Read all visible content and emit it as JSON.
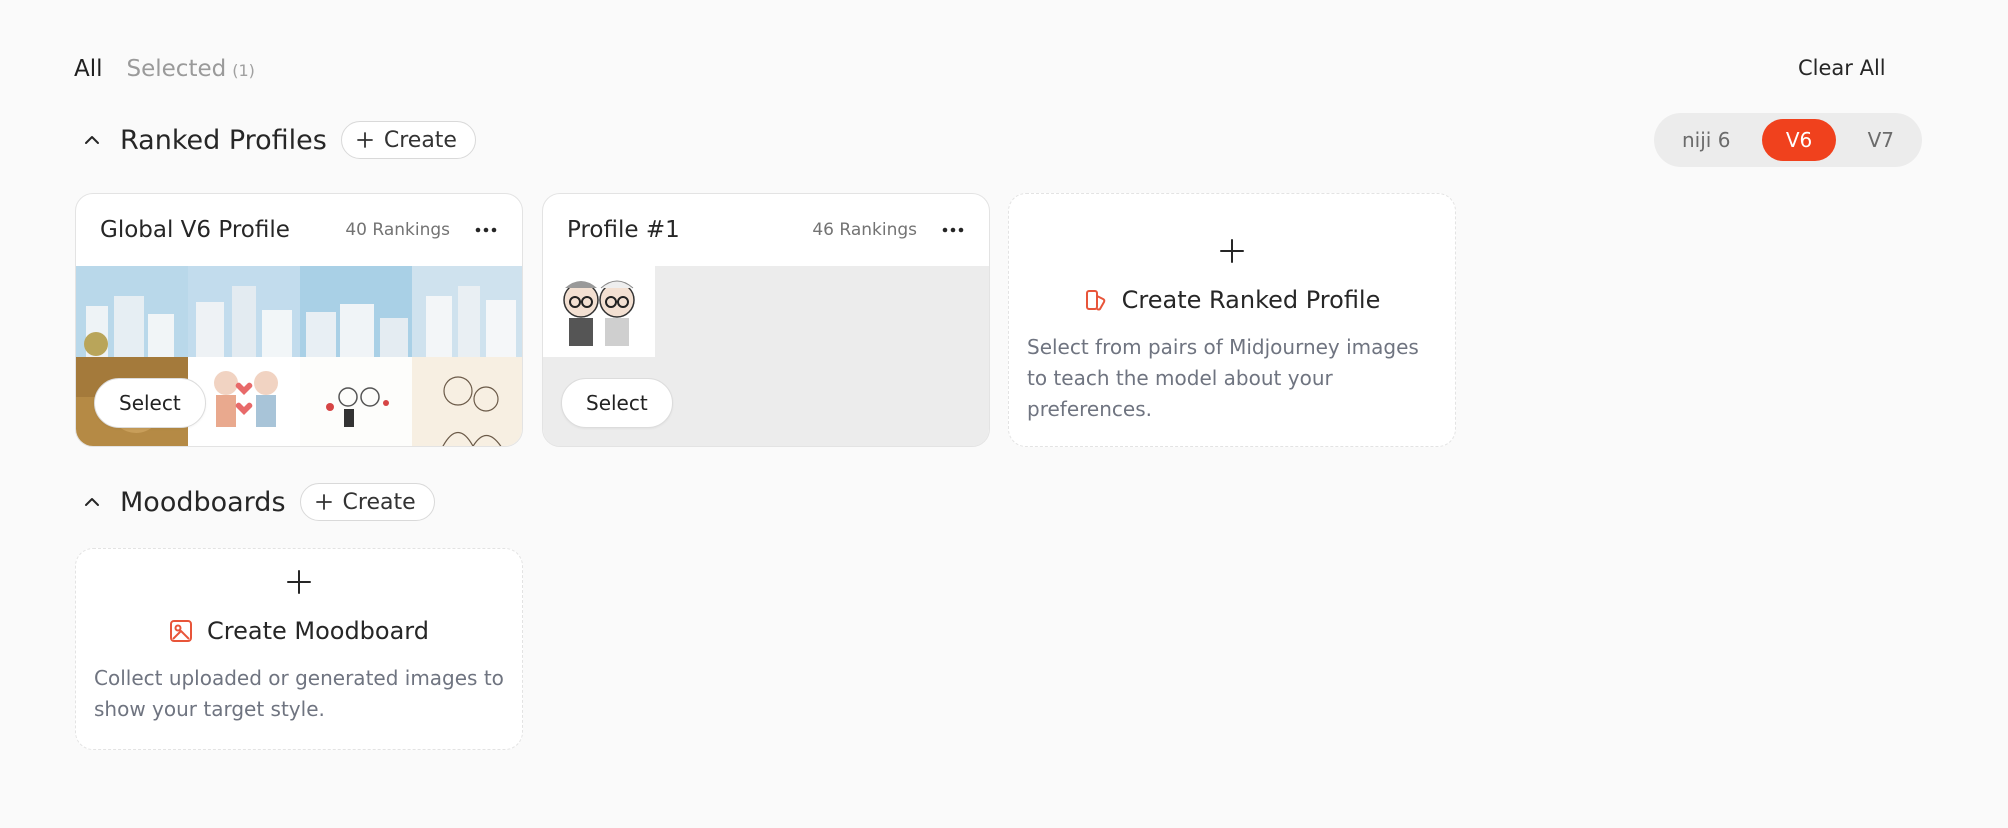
{
  "filters": {
    "all_label": "All",
    "selected_label": "Selected",
    "selected_count": "(1)"
  },
  "clear_all_label": "Clear All",
  "versions": {
    "options": [
      "niji 6",
      "V6",
      "V7"
    ],
    "active": "V6"
  },
  "ranked_profiles": {
    "title": "Ranked Profiles",
    "create_label": "Create",
    "cards": [
      {
        "title": "Global V6 Profile",
        "rankings": "40 Rankings",
        "select_label": "Select"
      },
      {
        "title": "Profile #1",
        "rankings": "46 Rankings",
        "select_label": "Select"
      }
    ],
    "create_card": {
      "title": "Create Ranked Profile",
      "description": "Select from pairs of Midjourney images to teach the model about your preferences."
    }
  },
  "moodboards": {
    "title": "Moodboards",
    "create_label": "Create",
    "create_card": {
      "title": "Create Moodboard",
      "description": "Collect uploaded or generated images to show your target style."
    }
  },
  "colors": {
    "accent": "#f0411d",
    "icon_accent": "#e8553a",
    "background": "#fafafa"
  },
  "icons": [
    "chevron-up-icon",
    "plus-icon",
    "more-horizontal-icon",
    "ranked-profile-icon",
    "moodboard-image-icon"
  ]
}
